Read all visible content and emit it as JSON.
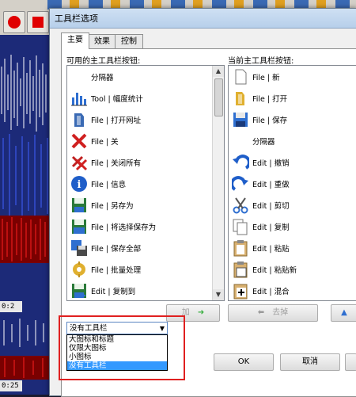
{
  "background": {
    "time_labels": [
      "0:2",
      "0:25"
    ]
  },
  "dialog": {
    "title": "工具栏选项",
    "tabs": [
      {
        "label": "主要",
        "active": true
      },
      {
        "label": "效果",
        "active": false
      },
      {
        "label": "控制",
        "active": false
      }
    ],
    "available_label": "可用的主工具栏按钮:",
    "current_label": "当前主工具栏按钮:",
    "available_items": [
      {
        "text": "分隔器",
        "icon": "separator"
      },
      {
        "text": "Tool | 幅度统计",
        "icon": "amplitude-stats-icon"
      },
      {
        "text": "File | 打开网址",
        "icon": "open-url-icon"
      },
      {
        "text": "File | 关",
        "icon": "close-icon"
      },
      {
        "text": "File | 关闭所有",
        "icon": "close-all-icon"
      },
      {
        "text": "File | 信息",
        "icon": "info-icon"
      },
      {
        "text": "File | 另存为",
        "icon": "save-as-icon"
      },
      {
        "text": "File | 将选择保存为",
        "icon": "save-selection-icon"
      },
      {
        "text": "File | 保存全部",
        "icon": "save-all-icon"
      },
      {
        "text": "File | 批量处理",
        "icon": "batch-icon"
      },
      {
        "text": "Edit | 复制到",
        "icon": "copy-to-icon"
      }
    ],
    "current_items": [
      {
        "text": "File | 新",
        "icon": "new-file-icon"
      },
      {
        "text": "File | 打开",
        "icon": "open-icon"
      },
      {
        "text": "File | 保存",
        "icon": "save-icon"
      },
      {
        "text": "分隔器",
        "icon": "separator"
      },
      {
        "text": "Edit | 撤销",
        "icon": "undo-icon"
      },
      {
        "text": "Edit | 重做",
        "icon": "redo-icon"
      },
      {
        "text": "Edit | 剪切",
        "icon": "cut-icon"
      },
      {
        "text": "Edit | 复制",
        "icon": "copy-icon"
      },
      {
        "text": "Edit | 粘贴",
        "icon": "paste-icon"
      },
      {
        "text": "Edit | 粘贴新",
        "icon": "paste-new-icon"
      },
      {
        "text": "Edit | 混合",
        "icon": "mix-icon"
      }
    ],
    "add_label": "加",
    "remove_label": "去掉",
    "toolbar_select": {
      "value": "没有工具栏",
      "options": [
        "大图标和标题",
        "仅限大图标",
        "小图标",
        "没有工具栏"
      ],
      "selected_index": 3
    },
    "ok_label": "OK",
    "cancel_label": "取消"
  }
}
